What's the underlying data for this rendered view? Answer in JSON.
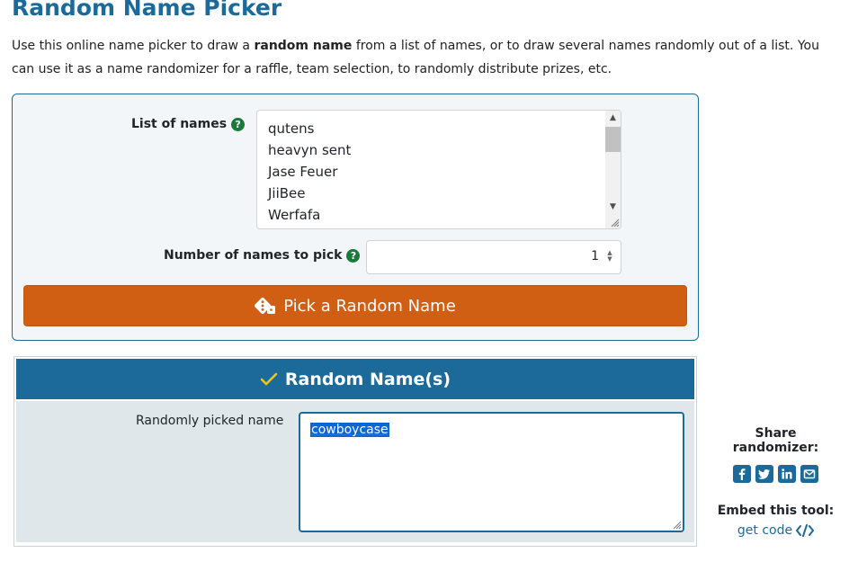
{
  "page": {
    "title": "Random Name Picker",
    "intro": {
      "part1": "Use this online name picker to draw a ",
      "bold": "random name",
      "part2": " from a list of names, or to draw several names randomly out of a list. You can use it as a name randomizer for a raffle, team selection, to randomly distribute prizes, etc."
    }
  },
  "form": {
    "names_label": "List of names",
    "names": [
      "qutens",
      "heavyn sent",
      "Jase Feuer",
      "JiiBee",
      "Werfafa"
    ],
    "count_label": "Number of names to pick",
    "count_value": "1",
    "help_icon_glyph": "?",
    "pick_button_label": "Pick a Random Name"
  },
  "result": {
    "header": "Random Name(s)",
    "label": "Randomly picked name",
    "value": "cowboycase"
  },
  "sidebar": {
    "share_title": "Share randomizer:",
    "share_icons": [
      "facebook-icon",
      "twitter-icon",
      "linkedin-icon",
      "email-icon"
    ],
    "embed_title": "Embed this tool:",
    "embed_link": "get code"
  },
  "colors": {
    "brand_blue": "#1c6a9a",
    "button_orange": "#d05f14",
    "help_green": "#1a7a3b",
    "check_yellow": "#f5c518"
  }
}
